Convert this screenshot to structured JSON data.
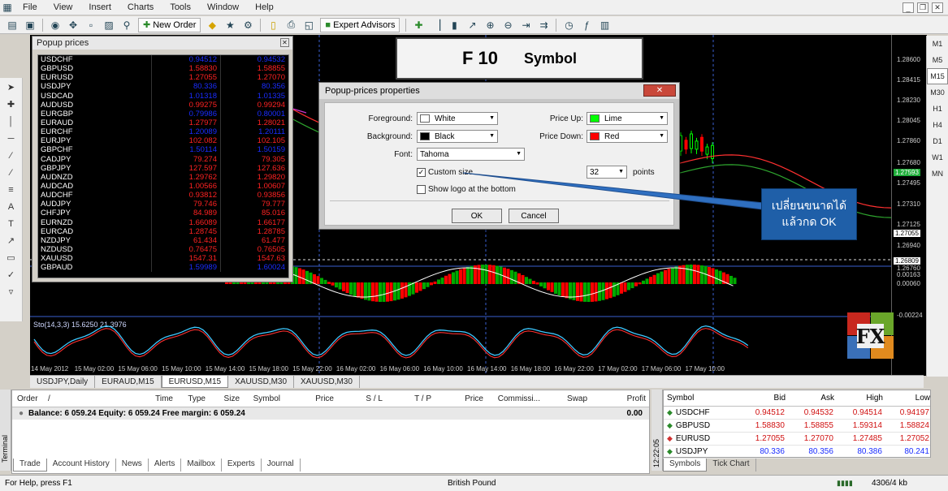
{
  "menu": [
    "File",
    "View",
    "Insert",
    "Charts",
    "Tools",
    "Window",
    "Help"
  ],
  "toolbar": {
    "new_order": "New Order",
    "expert_advisors": "Expert Advisors"
  },
  "timeframes": [
    "M1",
    "M5",
    "M15",
    "M30",
    "H1",
    "H4",
    "D1",
    "W1",
    "MN"
  ],
  "banner": {
    "key": "F 10",
    "label": "Symbol"
  },
  "popup": {
    "title": "Popup prices",
    "rows": [
      {
        "s": "USDCHF",
        "b": "0.94512",
        "a": "0.94532",
        "c": "#1a2dff"
      },
      {
        "s": "GBPUSD",
        "b": "1.58830",
        "a": "1.58855",
        "c": "#ff2222"
      },
      {
        "s": "EURUSD",
        "b": "1.27055",
        "a": "1.27070",
        "c": "#ff2222"
      },
      {
        "s": "USDJPY",
        "b": "80.336",
        "a": "80.356",
        "c": "#1a2dff"
      },
      {
        "s": "USDCAD",
        "b": "1.01318",
        "a": "1.01335",
        "c": "#1a2dff"
      },
      {
        "s": "AUDUSD",
        "b": "0.99275",
        "a": "0.99294",
        "c": "#ff2222"
      },
      {
        "s": "EURGBP",
        "b": "0.79986",
        "a": "0.80001",
        "c": "#1a2dff"
      },
      {
        "s": "EURAUD",
        "b": "1.27977",
        "a": "1.28021",
        "c": "#ff2222"
      },
      {
        "s": "EURCHF",
        "b": "1.20089",
        "a": "1.20111",
        "c": "#1a2dff"
      },
      {
        "s": "EURJPY",
        "b": "102.082",
        "a": "102.105",
        "c": "#ff2222"
      },
      {
        "s": "GBPCHF",
        "b": "1.50114",
        "a": "1.50159",
        "c": "#1a2dff"
      },
      {
        "s": "CADJPY",
        "b": "79.274",
        "a": "79.305",
        "c": "#ff2222"
      },
      {
        "s": "GBPJPY",
        "b": "127.597",
        "a": "127.636",
        "c": "#ff2222"
      },
      {
        "s": "AUDNZD",
        "b": "1.29762",
        "a": "1.29820",
        "c": "#ff2222"
      },
      {
        "s": "AUDCAD",
        "b": "1.00566",
        "a": "1.00607",
        "c": "#ff2222"
      },
      {
        "s": "AUDCHF",
        "b": "0.93812",
        "a": "0.93856",
        "c": "#ff2222"
      },
      {
        "s": "AUDJPY",
        "b": "79.746",
        "a": "79.777",
        "c": "#ff2222"
      },
      {
        "s": "CHFJPY",
        "b": "84.989",
        "a": "85.016",
        "c": "#ff2222"
      },
      {
        "s": "EURNZD",
        "b": "1.66089",
        "a": "1.66177",
        "c": "#ff2222"
      },
      {
        "s": "EURCAD",
        "b": "1.28745",
        "a": "1.28785",
        "c": "#ff2222"
      },
      {
        "s": "NZDJPY",
        "b": "61.434",
        "a": "61.477",
        "c": "#ff2222"
      },
      {
        "s": "NZDUSD",
        "b": "0.76475",
        "a": "0.76505",
        "c": "#ff2222"
      },
      {
        "s": "XAUUSD",
        "b": "1547.31",
        "a": "1547.63",
        "c": "#ff2222"
      },
      {
        "s": "GBPAUD",
        "b": "1.59989",
        "a": "1.60024",
        "c": "#1a2dff"
      }
    ]
  },
  "dialog": {
    "title": "Popup-prices properties",
    "foreground_label": "Foreground:",
    "foreground": "White",
    "foreground_color": "#ffffff",
    "background_label": "Background:",
    "background": "Black",
    "background_color": "#000000",
    "font_label": "Font:",
    "font": "Tahoma",
    "price_up_label": "Price Up:",
    "price_up": "Lime",
    "price_up_color": "#00ff00",
    "price_down_label": "Price Down:",
    "price_down": "Red",
    "price_down_color": "#ff0000",
    "custom_size": "Custom size",
    "size_value": "32",
    "points": "points",
    "show_logo": "Show logo at the bottom",
    "ok": "OK",
    "cancel": "Cancel"
  },
  "callout": {
    "line1": "เปลี่ยนขนาดได้",
    "line2": "แล้วกด OK"
  },
  "chart": {
    "indicator": "Sto(14,3,3) 15.6250 21.3976",
    "prices": [
      "1.28600",
      "1.28415",
      "1.28230",
      "1.28045",
      "1.27860",
      "1.27680",
      "1.27593",
      "1.27495",
      "1.27310",
      "1.27125",
      "1.27055",
      "1.26940",
      "1.26809",
      "1.26760",
      "0.00163",
      "0.00060",
      "-0.00224"
    ],
    "price_tags": {
      "green": "1.27593",
      "white": "1.27055",
      "dash": "1.26809"
    },
    "times": [
      "14 May 2012",
      "15 May 02:00",
      "15 May 06:00",
      "15 May 10:00",
      "15 May 14:00",
      "15 May 18:00",
      "15 May 22:00",
      "16 May 02:00",
      "16 May 06:00",
      "16 May 10:00",
      "16 May 14:00",
      "16 May 18:00",
      "16 May 22:00",
      "17 May 02:00",
      "17 May 06:00",
      "17 May 10:00"
    ],
    "tabs": [
      "USDJPY,Daily",
      "EURAUD,M15",
      "EURUSD,M15",
      "XAUUSD,M30",
      "XAUUSD,M30"
    ]
  },
  "terminal": {
    "cols": [
      "Order",
      "/",
      "Time",
      "Type",
      "Size",
      "Symbol",
      "Price",
      "S / L",
      "T / P",
      "Price",
      "Commissi...",
      "Swap",
      "Profit"
    ],
    "summary": "Balance: 6 059.24  Equity: 6 059.24  Free margin: 6 059.24",
    "profit": "0.00",
    "tabs": [
      "Trade",
      "Account History",
      "News",
      "Alerts",
      "Mailbox",
      "Experts",
      "Journal"
    ],
    "side": "Terminal"
  },
  "market": {
    "cols": [
      "Symbol",
      "Bid",
      "Ask",
      "High",
      "Low"
    ],
    "rows": [
      {
        "s": "USDCHF",
        "bid": "0.94512",
        "ask": "0.94532",
        "high": "0.94514",
        "low": "0.94197"
      },
      {
        "s": "GBPUSD",
        "bid": "1.58830",
        "ask": "1.58855",
        "high": "1.59314",
        "low": "1.58824"
      },
      {
        "s": "EURUSD",
        "bid": "1.27055",
        "ask": "1.27070",
        "high": "1.27485",
        "low": "1.27052"
      },
      {
        "s": "USDJPY",
        "bid": "80.336",
        "ask": "80.356",
        "high": "80.386",
        "low": "80.241"
      }
    ],
    "tabs": [
      "Symbols",
      "Tick Chart"
    ],
    "side": "12:22:05"
  },
  "status": {
    "help": "For Help, press F1",
    "profile": "British Pound",
    "traffic": "4306/4 kb"
  }
}
